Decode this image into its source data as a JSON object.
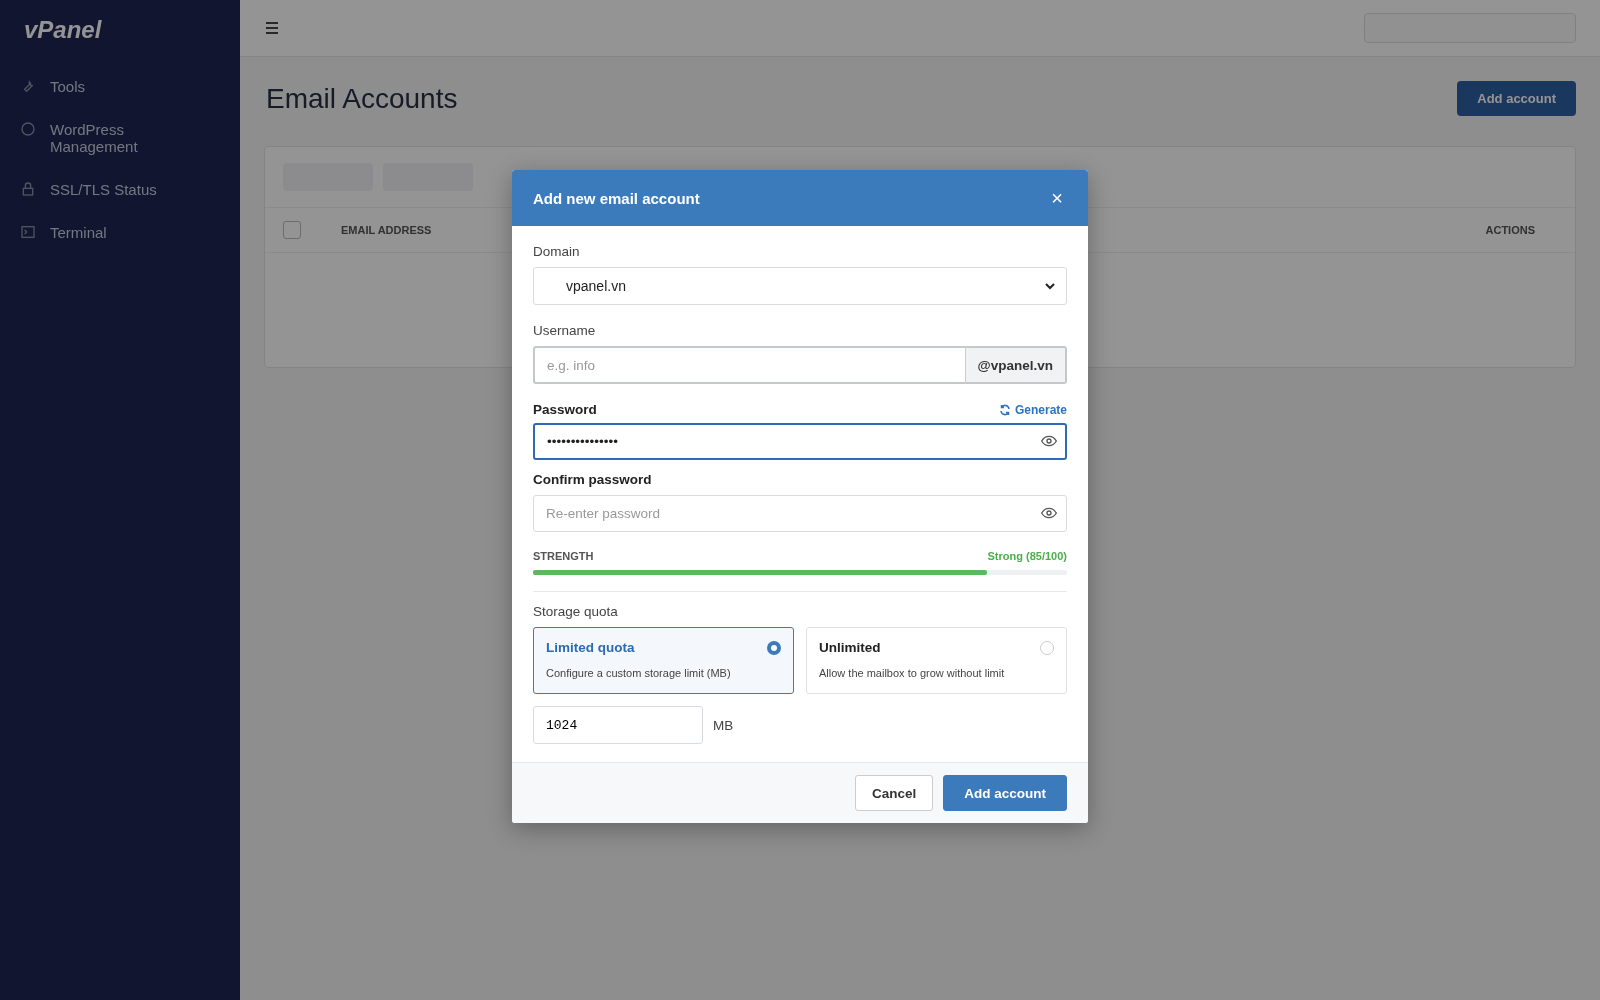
{
  "sidebar": {
    "logo": "vPanel",
    "items": [
      {
        "label": "Tools"
      },
      {
        "label": "WordPress Management"
      },
      {
        "label": "SSL/TLS Status"
      },
      {
        "label": "Terminal"
      }
    ]
  },
  "page": {
    "title": "Email Accounts",
    "add_button": "Add account",
    "select_all_checked": false,
    "columns": [
      "EMAIL ADDRESS",
      "ACTIONS"
    ]
  },
  "modal": {
    "title": "Add new email account",
    "close": "×",
    "domain": {
      "label": "Domain",
      "value": "vpanel.vn"
    },
    "username": {
      "label": "Username",
      "placeholder": "e.g. info",
      "suffix": "@vpanel.vn"
    },
    "password": {
      "label": "Password",
      "value": "•••••••••••••••",
      "focused": true,
      "generate": "Generate"
    },
    "confirm": {
      "label": "Confirm password",
      "placeholder": "Re-enter password",
      "focused": false
    },
    "strength": {
      "label": "STRENGTH",
      "reading": "Strong (85/100)",
      "level": 0.85
    },
    "quota": {
      "label": "Storage quota",
      "options": [
        {
          "title": "Limited quota",
          "description": "Configure a custom storage limit (MB)",
          "selected": true
        },
        {
          "title": "Unlimited",
          "description": "Allow the mailbox to grow without limit",
          "selected": false
        }
      ],
      "value": "1024",
      "unit": "MB"
    },
    "buttons": [
      {
        "label": "Cancel",
        "kind": "secondary"
      },
      {
        "label": "Add account",
        "kind": "primary"
      }
    ]
  }
}
